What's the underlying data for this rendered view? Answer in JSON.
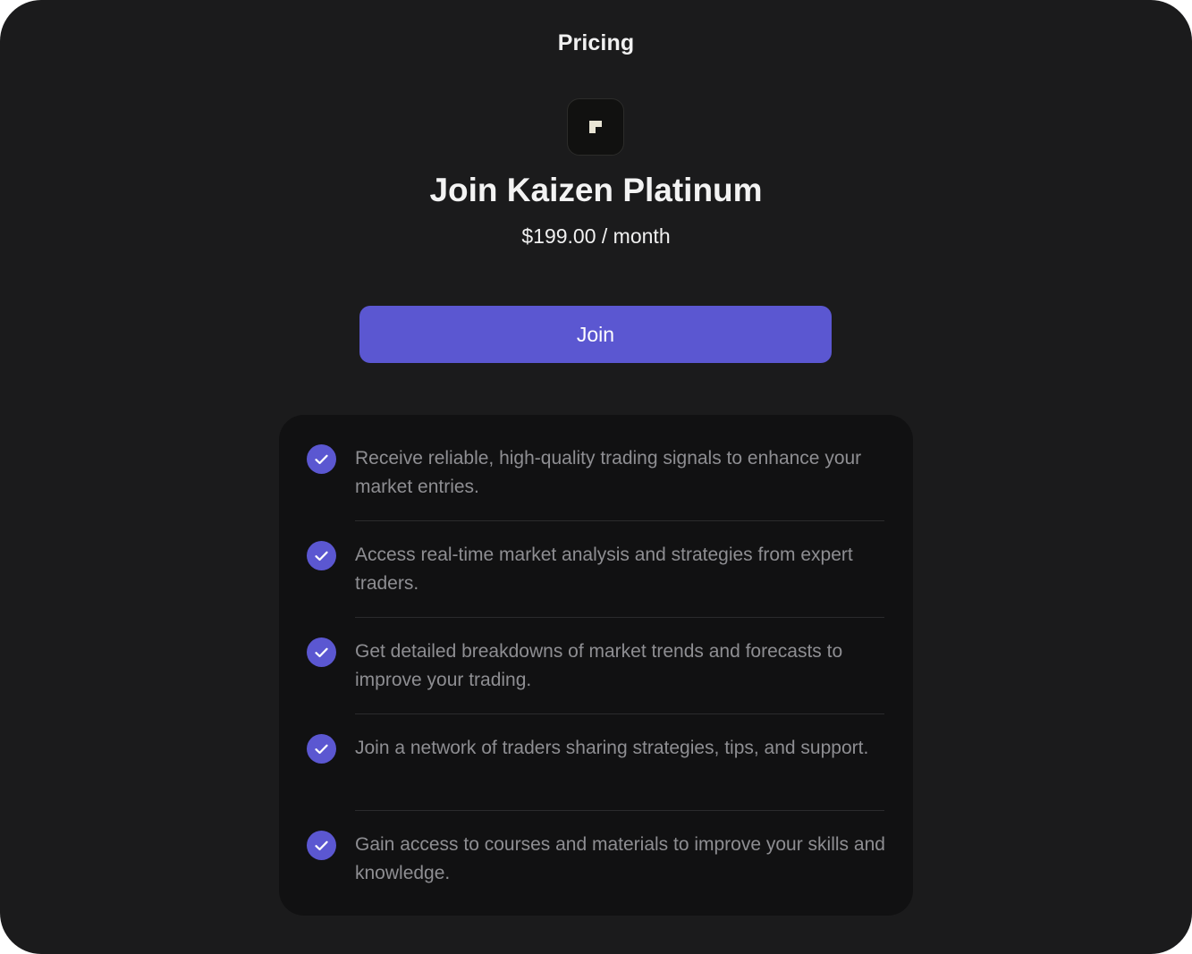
{
  "header": {
    "title": "Pricing"
  },
  "logo": {
    "icon": "kaizen-logo-icon"
  },
  "product": {
    "title": "Join Kaizen Platinum",
    "price": "$199.00 / month"
  },
  "cta": {
    "label": "Join",
    "color": "#5b57d1"
  },
  "features": [
    {
      "icon": "check-circle-icon",
      "text": "Receive reliable, high-quality trading signals to enhance your market entries."
    },
    {
      "icon": "check-circle-icon",
      "text": "Access real-time market analysis and strategies from expert traders."
    },
    {
      "icon": "check-circle-icon",
      "text": "Get detailed breakdowns of market trends and forecasts to improve your trading."
    },
    {
      "icon": "check-circle-icon",
      "text": "Join a network of traders sharing strategies, tips, and support."
    },
    {
      "icon": "check-circle-icon",
      "text": "Gain access to courses and materials to improve your skills and knowledge."
    }
  ],
  "colors": {
    "background": "#1b1b1c",
    "card": "#111112",
    "accent": "#5b57d1",
    "muted_text": "#8e8e92"
  }
}
